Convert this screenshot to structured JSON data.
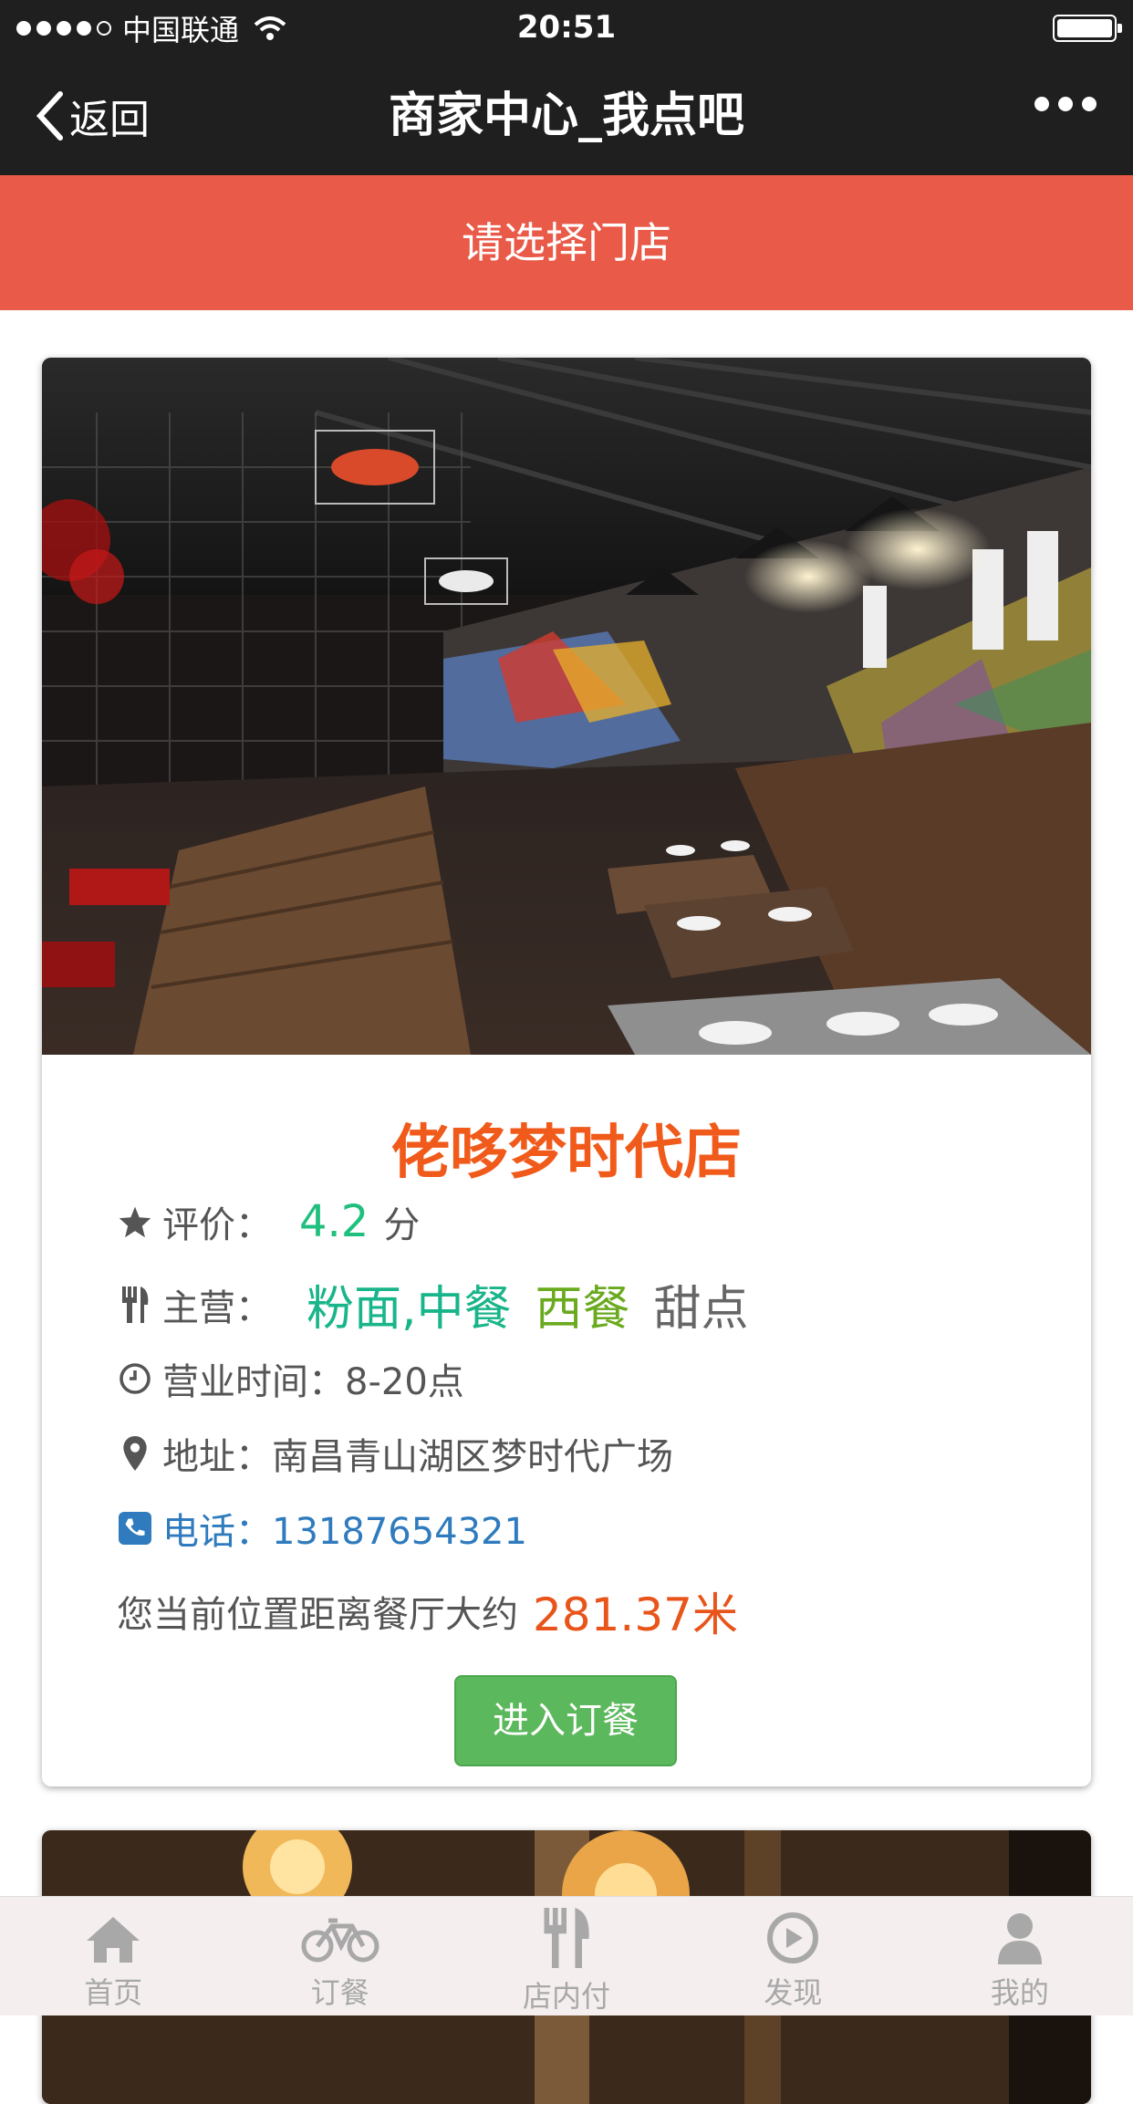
{
  "status_bar": {
    "carrier": "中国联通",
    "time": "20:51"
  },
  "nav": {
    "back_label": "返回",
    "title": "商家中心_我点吧"
  },
  "banner": {
    "text": "请选择门店"
  },
  "store": {
    "name": "佬哆梦时代店",
    "rating_label": "评价：",
    "rating_value": "4.2",
    "rating_unit": "分",
    "cuisine_label": "主营：",
    "cuisine_tags": [
      "粉面,中餐",
      "西餐",
      "甜点"
    ],
    "hours": "营业时间：8-20点",
    "address": "地址：南昌青山湖区梦时代广场",
    "phone": "电话：13187654321",
    "distance_prefix": "您当前位置距离餐厅大约",
    "distance_value": "281.37米",
    "order_button": "进入订餐"
  },
  "tabs": [
    {
      "label": "首页",
      "icon": "home-icon"
    },
    {
      "label": "订餐",
      "icon": "bicycle-icon"
    },
    {
      "label": "店内付",
      "icon": "fork-knife-icon"
    },
    {
      "label": "发现",
      "icon": "compass-icon"
    },
    {
      "label": "我的",
      "icon": "user-icon"
    }
  ],
  "colors": {
    "banner": "#e95a48",
    "accent_name": "#f05a1a",
    "rating": "#1fbf7e",
    "button": "#5cb85c"
  }
}
